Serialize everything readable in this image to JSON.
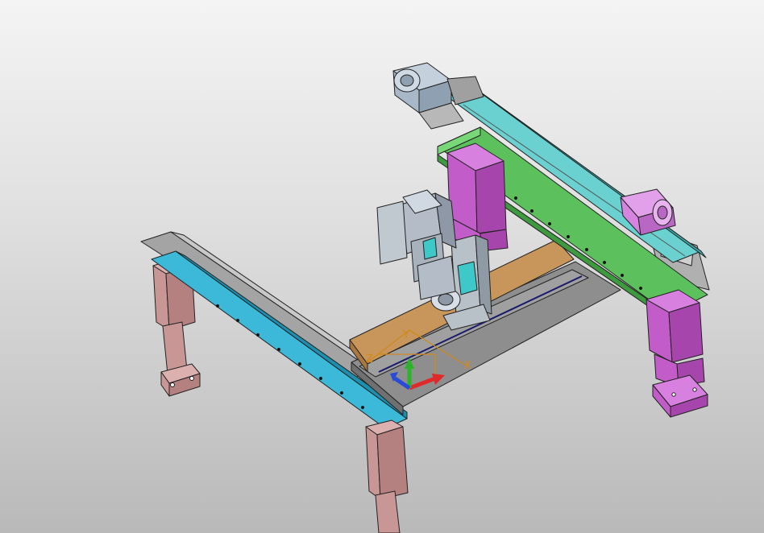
{
  "viewport": {
    "background_top": "#f4f4f4",
    "background_bottom": "#b9b9b9"
  },
  "model": {
    "parts": [
      {
        "name": "left-support-leg-front",
        "color": "#c99696"
      },
      {
        "name": "left-support-leg-rear",
        "color": "#c99696"
      },
      {
        "name": "left-beam",
        "color": "#2ea8c8"
      },
      {
        "name": "left-rail",
        "color": "#9a9a9a"
      },
      {
        "name": "base-plate",
        "color": "#8c8c8c"
      },
      {
        "name": "wood-plate",
        "color": "#c8955a"
      },
      {
        "name": "x-gantry-beam",
        "color": "#5cc05c"
      },
      {
        "name": "x-gantry-rail",
        "color": "#5ec2c2"
      },
      {
        "name": "right-support-leg-front",
        "color": "#c25cc8"
      },
      {
        "name": "right-support-leg-rear",
        "color": "#c25cc8"
      },
      {
        "name": "z-axis-carriage",
        "color": "#c25cc8"
      },
      {
        "name": "servo-motor-top",
        "color": "#a8b8c8"
      },
      {
        "name": "servo-motor-right",
        "color": "#d585e0"
      },
      {
        "name": "spindle-head",
        "color": "#b4bcc8"
      }
    ]
  },
  "triad": {
    "x_label": "X",
    "y_label": "Y",
    "z_label": "Z",
    "x_color": "#e02a2a",
    "y_color": "#2ab42a",
    "z_color": "#2a4ad8",
    "label_color": "#d08a1a"
  }
}
